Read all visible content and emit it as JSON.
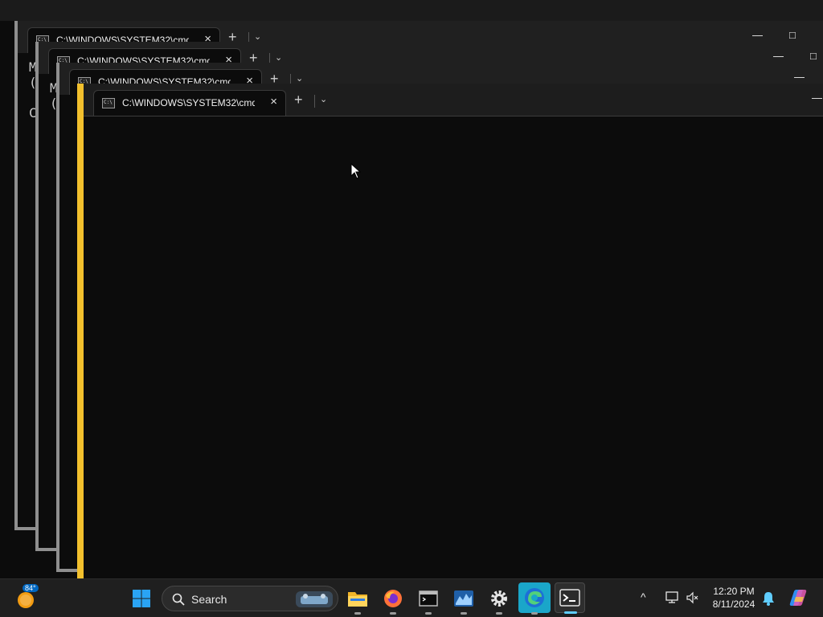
{
  "windows": [
    {
      "tab_title": "C:\\WINDOWS\\SYSTEM32\\cmd",
      "body_lines": [
        "M",
        "(",
        "",
        "C"
      ]
    },
    {
      "tab_title": "C:\\WINDOWS\\SYSTEM32\\cmd",
      "body_lines": [
        "M",
        "("
      ]
    },
    {
      "tab_title": "C:\\WINDOWS\\SYSTEM32\\cmd",
      "body_lines": []
    },
    {
      "tab_title": "C:\\WINDOWS\\SYSTEM32\\cmd",
      "body_lines": []
    }
  ],
  "tab_close_glyph": "×",
  "new_tab_glyph": "+",
  "dropdown_glyph": "⌄",
  "minimize_glyph": "—",
  "maximize_glyph": "□",
  "taskbar": {
    "weather": {
      "temperature": "84°",
      "icon": "weather-sun-icon"
    },
    "search_label": "Search",
    "apps": [
      "start-icon",
      "file-explorer-icon",
      "firefox-icon",
      "terminal-icon",
      "stock-chart-icon",
      "settings-icon",
      "edge-icon",
      "windows-terminal-icon"
    ],
    "clock": {
      "time": "12:20 PM",
      "date": "8/11/2024"
    },
    "tray_chevron": "^"
  },
  "colors": {
    "active_window_accent": "#f2c02d",
    "inactive_window_border": "#8f8f8f",
    "taskbar_accent": "#60cdff"
  }
}
